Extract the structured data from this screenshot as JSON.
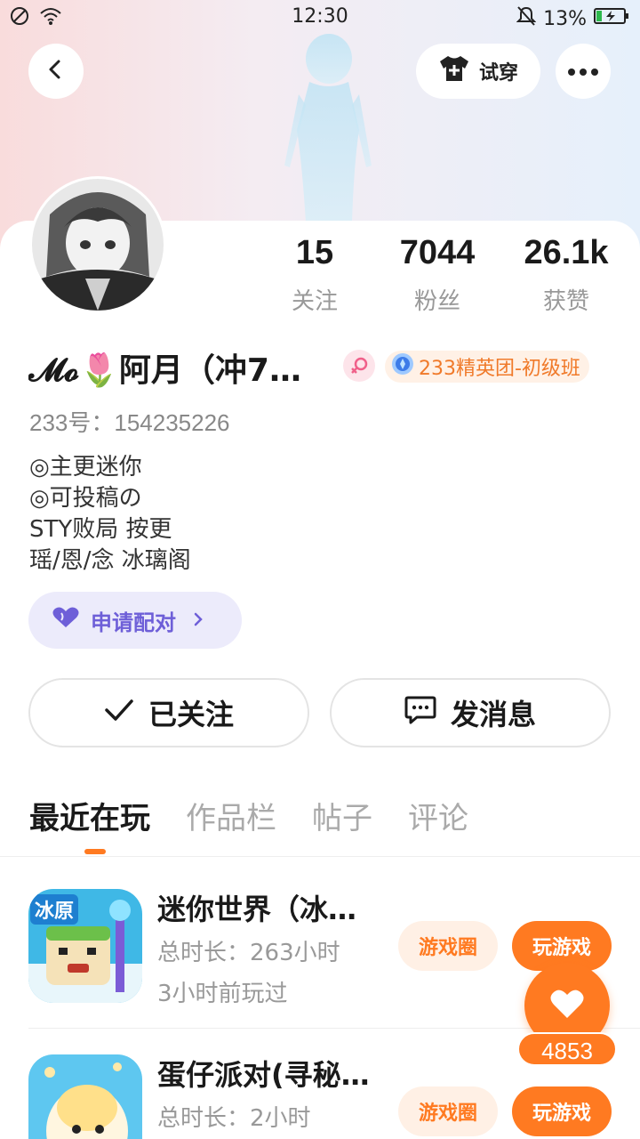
{
  "status_bar": {
    "time": "12:30",
    "battery": "13%",
    "icons": [
      "no-sim-icon",
      "wifi-icon",
      "mute-icon",
      "battery-charging-icon"
    ]
  },
  "header": {
    "try_on_label": "试穿",
    "icons": [
      "back-arrow-icon",
      "tshirt-icon",
      "more-icon"
    ]
  },
  "profile": {
    "name": "𝓜𝓸🌷阿月（冲7…",
    "gender_icon": "female-icon",
    "badge": "233精英团-初级班",
    "uid": "233号：154235226",
    "bio": [
      "◎主更迷你",
      "◎可投稿の",
      "STY败局 按更",
      "瑶/恩/念 冰璃阁"
    ],
    "pair_button": "申请配对"
  },
  "stats": [
    {
      "value": "15",
      "label": "关注"
    },
    {
      "value": "7044",
      "label": "粉丝"
    },
    {
      "value": "26.1k",
      "label": "获赞"
    }
  ],
  "actions": {
    "follow_label": "已关注",
    "message_label": "发消息"
  },
  "tabs": [
    "最近在玩",
    "作品栏",
    "帖子",
    "评论"
  ],
  "games": [
    {
      "title": "迷你世界（冰…",
      "duration": "总时长：263小时",
      "last_played": "3小时前玩过",
      "circle_label": "游戏圈",
      "play_label": "玩游戏",
      "icon_text": "冰原"
    },
    {
      "title": "蛋仔派对(寻秘…",
      "duration": "总时长：2小时",
      "circle_label": "游戏圈",
      "play_label": "玩游戏"
    }
  ],
  "like": {
    "count": "4853"
  },
  "colors": {
    "accent": "#ff7a21",
    "pair_purple": "#6e5fd8",
    "badge_orange": "#f07a2a"
  }
}
